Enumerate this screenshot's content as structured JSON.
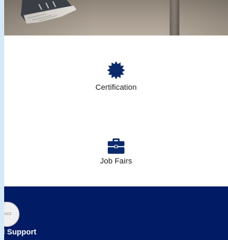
{
  "hero": {
    "image": "sneaker-on-pavement-photo"
  },
  "tiles": [
    {
      "icon": "certificate-badge-icon",
      "label": "Certification"
    },
    {
      "icon": "briefcase-icon",
      "label": "Job Fairs"
    }
  ],
  "footer": {
    "logo_text": "ccccc",
    "label": "l Support"
  },
  "colors": {
    "page_bg": "#d6e9f6",
    "icon_navy": "#0b2a6b",
    "footer_navy": "#011b64",
    "text": "#1a1a1a",
    "white": "#ffffff"
  }
}
